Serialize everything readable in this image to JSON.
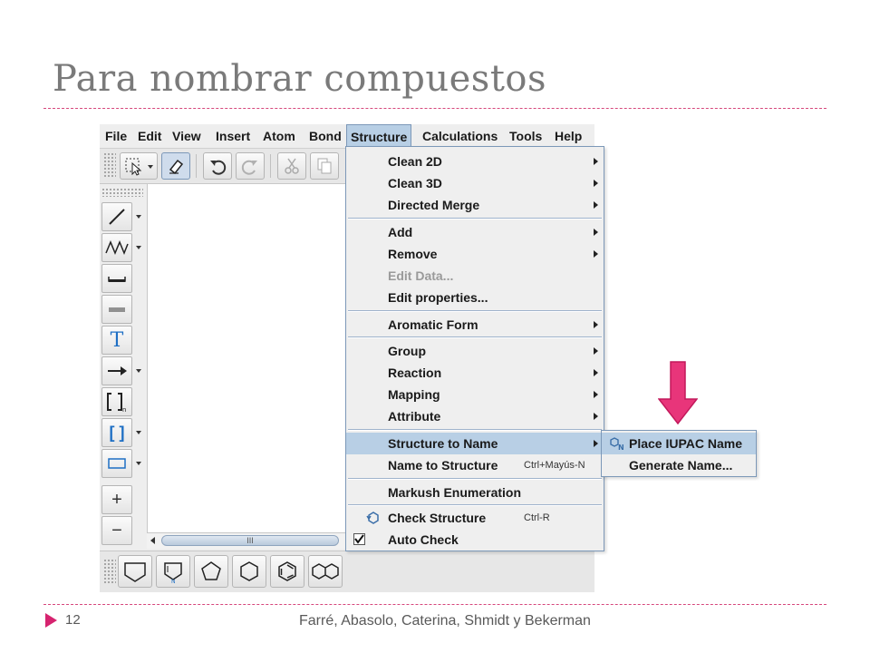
{
  "slide": {
    "title": "Para nombrar compuestos",
    "page_number": "12",
    "footer": "Farré, Abasolo, Caterina, Shmidt y Bekerman"
  },
  "app": {
    "menubar": [
      "File",
      "Edit",
      "View",
      "Insert",
      "Atom",
      "Bond",
      "Structure",
      "Calculations",
      "Tools",
      "Help"
    ],
    "active_menu": "Structure",
    "toolbar_icons": [
      "selection-arrow-icon",
      "eraser-icon",
      "undo-icon",
      "redo-icon",
      "cut-icon",
      "copy-icon"
    ],
    "left_tools": [
      "single-bond-icon",
      "chain-icon",
      "bold-bond-icon",
      "hashed-bond-icon",
      "text-tool-icon",
      "reaction-arrow-icon",
      "sgroup-bracket-icon",
      "bracket-icon",
      "rectangle-icon",
      "zoom-in-icon",
      "zoom-out-icon"
    ],
    "text_tool_label": "T",
    "bracket_label": "[ ]",
    "plus_label": "+",
    "minus_label": "−",
    "scroll_grip": "III",
    "bottom_templates": [
      "cyclopentane-ring-icon",
      "pyrrole-ring-icon",
      "cyclopentene-ring-icon",
      "cyclohexane-ring-icon",
      "benzene-ring-icon",
      "naphthalene-ring-icon"
    ]
  },
  "structure_menu": {
    "items": [
      {
        "label": "Clean 2D",
        "submenu": true
      },
      {
        "label": "Clean 3D",
        "submenu": true
      },
      {
        "label": "Directed Merge",
        "submenu": true
      },
      {
        "label": "Add",
        "submenu": true
      },
      {
        "label": "Remove",
        "submenu": true
      },
      {
        "label": "Edit Data...",
        "disabled": true
      },
      {
        "label": "Edit properties..."
      },
      {
        "label": "Aromatic Form",
        "submenu": true
      },
      {
        "label": "Group",
        "submenu": true
      },
      {
        "label": "Reaction",
        "submenu": true
      },
      {
        "label": "Mapping",
        "submenu": true
      },
      {
        "label": "Attribute",
        "submenu": true
      },
      {
        "label": "Structure to Name",
        "submenu": true,
        "highlighted": true
      },
      {
        "label": "Name to Structure",
        "shortcut": "Ctrl+Mayús-N"
      },
      {
        "label": "Markush Enumeration"
      },
      {
        "label": "Check Structure",
        "shortcut": "Ctrl-R",
        "icon": "check-structure-icon"
      },
      {
        "label": "Auto Check",
        "checked": true
      }
    ]
  },
  "submenu": {
    "items": [
      {
        "label": "Place IUPAC Name",
        "icon": "iupac-name-icon",
        "highlighted": true
      },
      {
        "label": "Generate Name..."
      }
    ]
  },
  "colors": {
    "accent_pink": "#e8357a",
    "menu_highlight": "#b8cfe5",
    "dash_line": "#d6477c"
  }
}
